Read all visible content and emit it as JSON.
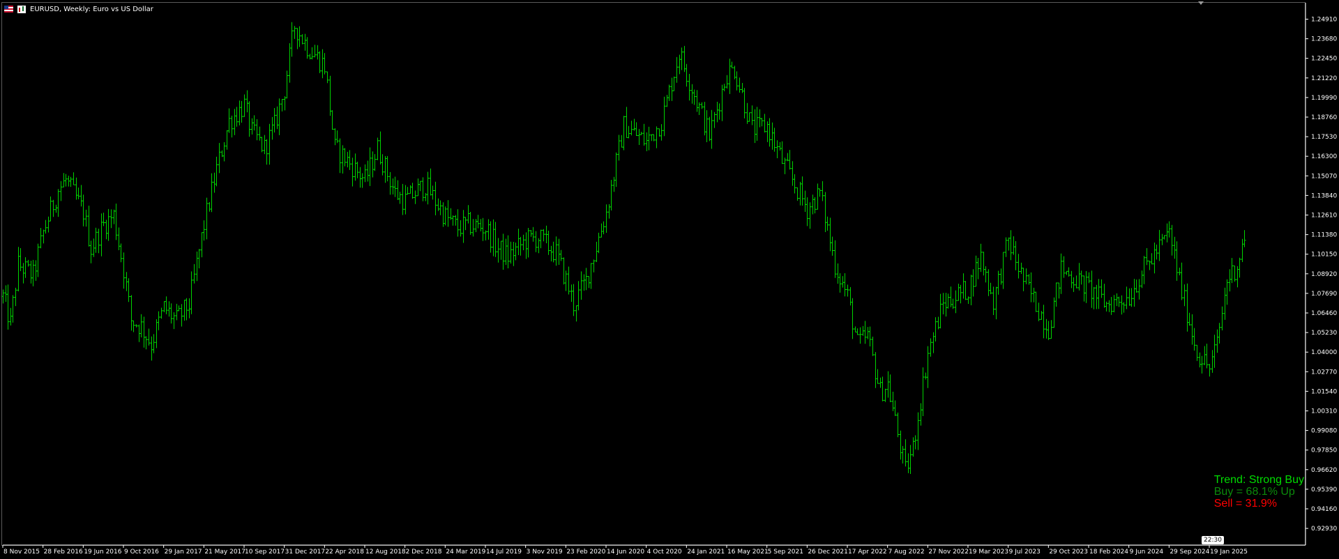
{
  "window": {
    "title": "EURUSD, Weekly:  Euro vs US Dollar",
    "symbol_icon": "flag-icon",
    "chart_type_icon": "chart-icon"
  },
  "panel": {
    "trend": "Trend: Strong Buy",
    "buy": "Buy = 68.1% Up",
    "sell": "Sell = 31.9%",
    "colors": {
      "trend": "#00dc00",
      "buy": "#0b8a0b",
      "sell": "#ff0000"
    }
  },
  "time_badge": "22:30",
  "colors": {
    "background": "#000000",
    "bars": "#00d400",
    "axis": "#ffffff",
    "frame": "#5a5a5a"
  },
  "chart_data": {
    "type": "ohlc",
    "title": "EURUSD, Weekly:  Euro vs US Dollar",
    "timeframe": "Weekly",
    "grid": false,
    "ylim": [
      0.9206,
      1.2545
    ],
    "y_ticks": [
      "1.24910",
      "1.23680",
      "1.22450",
      "1.21220",
      "1.19990",
      "1.18760",
      "1.17530",
      "1.16300",
      "1.15070",
      "1.13840",
      "1.12610",
      "1.11380",
      "1.10150",
      "1.08920",
      "1.07690",
      "1.06460",
      "1.05230",
      "1.04000",
      "1.02770",
      "1.01540",
      "1.00310",
      "0.99080",
      "0.97850",
      "0.96620",
      "0.95390",
      "0.94160",
      "0.92930"
    ],
    "x_ticks": [
      "8 Nov 2015",
      "28 Feb 2016",
      "19 Jun 2016",
      "9 Oct 2016",
      "29 Jan 2017",
      "21 May 2017",
      "10 Sep 2017",
      "31 Dec 2017",
      "22 Apr 2018",
      "12 Aug 2018",
      "2 Dec 2018",
      "24 Mar 2019",
      "14 Jul 2019",
      "3 Nov 2019",
      "23 Feb 2020",
      "14 Jun 2020",
      "4 Oct 2020",
      "24 Jan 2021",
      "16 May 2021",
      "5 Sep 2021",
      "26 Dec 2021",
      "17 Apr 2022",
      "7 Aug 2022",
      "27 Nov 2022",
      "19 Mar 2023",
      "9 Jul 2023",
      "29 Oct 2023",
      "18 Feb 2024",
      "9 Jun 2024",
      "29 Sep 2024",
      "19 Jan 2025"
    ],
    "close_path": [
      [
        "8 Nov 2015",
        1.075
      ],
      [
        "29 Nov 2015",
        1.058
      ],
      [
        "20 Dec 2015",
        1.095
      ],
      [
        "31 Jan 2016",
        1.088
      ],
      [
        "28 Feb 2016",
        1.115
      ],
      [
        "10 Apr 2016",
        1.142
      ],
      [
        "1 May 2016",
        1.148
      ],
      [
        "19 Jun 2016",
        1.128
      ],
      [
        "10 Jul 2016",
        1.105
      ],
      [
        "14 Aug 2016",
        1.12
      ],
      [
        "11 Sep 2016",
        1.126
      ],
      [
        "9 Oct 2016",
        1.092
      ],
      [
        "30 Oct 2016",
        1.06
      ],
      [
        "27 Nov 2016",
        1.056
      ],
      [
        "25 Dec 2016",
        1.045
      ],
      [
        "29 Jan 2017",
        1.068
      ],
      [
        "5 Mar 2017",
        1.06
      ],
      [
        "9 Apr 2017",
        1.07
      ],
      [
        "21 May 2017",
        1.12
      ],
      [
        "25 Jun 2017",
        1.155
      ],
      [
        "30 Jul 2017",
        1.185
      ],
      [
        "10 Sep 2017",
        1.195
      ],
      [
        "1 Oct 2017",
        1.178
      ],
      [
        "5 Nov 2017",
        1.168
      ],
      [
        "3 Dec 2017",
        1.182
      ],
      [
        "31 Dec 2017",
        1.205
      ],
      [
        "28 Jan 2018",
        1.245
      ],
      [
        "4 Mar 2018",
        1.232
      ],
      [
        "22 Apr 2018",
        1.22
      ],
      [
        "20 May 2018",
        1.168
      ],
      [
        "17 Jun 2018",
        1.162
      ],
      [
        "12 Aug 2018",
        1.148
      ],
      [
        "16 Sep 2018",
        1.168
      ],
      [
        "4 Nov 2018",
        1.14
      ],
      [
        "2 Dec 2018",
        1.135
      ],
      [
        "27 Jan 2019",
        1.145
      ],
      [
        "24 Mar 2019",
        1.125
      ],
      [
        "28 Apr 2019",
        1.118
      ],
      [
        "26 May 2019",
        1.12
      ],
      [
        "14 Jul 2019",
        1.118
      ],
      [
        "18 Aug 2019",
        1.105
      ],
      [
        "15 Sep 2019",
        1.1
      ],
      [
        "3 Nov 2019",
        1.11
      ],
      [
        "8 Dec 2019",
        1.112
      ],
      [
        "26 Jan 2020",
        1.102
      ],
      [
        "23 Feb 2020",
        1.085
      ],
      [
        "15 Mar 2020",
        1.07
      ],
      [
        "19 Apr 2020",
        1.085
      ],
      [
        "14 Jun 2020",
        1.128
      ],
      [
        "2 Aug 2020",
        1.182
      ],
      [
        "4 Oct 2020",
        1.172
      ],
      [
        "15 Nov 2020",
        1.185
      ],
      [
        "3 Jan 2021",
        1.228
      ],
      [
        "24 Jan 2021",
        1.215
      ],
      [
        "28 Mar 2021",
        1.176
      ],
      [
        "16 May 2021",
        1.215
      ],
      [
        "6 Jun 2021",
        1.218
      ],
      [
        "25 Jul 2021",
        1.18
      ],
      [
        "5 Sep 2021",
        1.182
      ],
      [
        "17 Oct 2021",
        1.16
      ],
      [
        "26 Dec 2021",
        1.13
      ],
      [
        "30 Jan 2022",
        1.14
      ],
      [
        "13 Mar 2022",
        1.095
      ],
      [
        "17 Apr 2022",
        1.075
      ],
      [
        "15 May 2022",
        1.045
      ],
      [
        "12 Jun 2022",
        1.05
      ],
      [
        "17 Jul 2022",
        1.015
      ],
      [
        "7 Aug 2022",
        1.02
      ],
      [
        "25 Sep 2022",
        0.965
      ],
      [
        "16 Oct 2022",
        0.98
      ],
      [
        "27 Nov 2022",
        1.04
      ],
      [
        "8 Jan 2023",
        1.07
      ],
      [
        "19 Mar 2023",
        1.08
      ],
      [
        "23 Apr 2023",
        1.1
      ],
      [
        "28 May 2023",
        1.072
      ],
      [
        "9 Jul 2023",
        1.11
      ],
      [
        "20 Aug 2023",
        1.085
      ],
      [
        "29 Oct 2023",
        1.055
      ],
      [
        "3 Dec 2023",
        1.092
      ],
      [
        "18 Feb 2024",
        1.08
      ],
      [
        "7 Apr 2024",
        1.07
      ],
      [
        "9 Jun 2024",
        1.075
      ],
      [
        "14 Jul 2024",
        1.09
      ],
      [
        "29 Sep 2024",
        1.115
      ],
      [
        "3 Nov 2024",
        1.078
      ],
      [
        "15 Dec 2024",
        1.04
      ],
      [
        "19 Jan 2025",
        1.03
      ],
      [
        "9 Feb 2025",
        1.045
      ],
      [
        "9 Mar 2025",
        1.085
      ],
      [
        "6 Apr 2025",
        1.095
      ],
      [
        "27 Apr 2025",
        1.112
      ]
    ]
  }
}
